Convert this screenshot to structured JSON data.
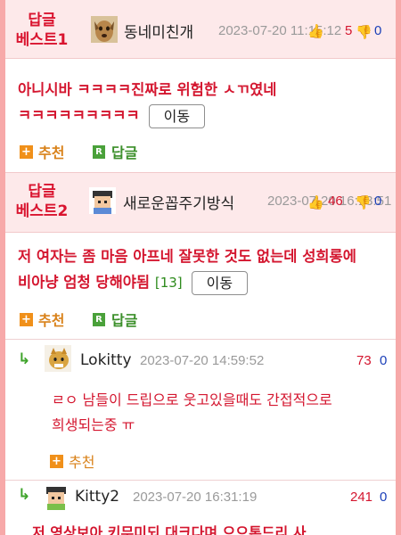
{
  "best1": {
    "label_line1": "답글",
    "label_line2": "베스트1",
    "nickname": "동네미친개",
    "date": "2023-07-20 11:15:12",
    "likes": "5",
    "dislikes": "0",
    "body": "아니시바 ㅋㅋㅋㅋ진짜로 위험한 ㅅㄲ였네 ㅋㅋㅋㅋㅋㅋㅋㅋㅋ",
    "move_label": "이동",
    "recommend_label": "추천",
    "reply_label": "답글"
  },
  "best2": {
    "label_line1": "답글",
    "label_line2": "베스트2",
    "nickname": "새로운꼽주기방식",
    "date": "2023-07-20 16:13:51",
    "likes": "46",
    "dislikes": "0",
    "body": "저 여자는 좀 마음 아프네 잘못한 것도 없는데 성희롱에 비아냥 엄청 당해야됨",
    "reply_count": "[13]",
    "move_label": "이동",
    "recommend_label": "추천",
    "reply_label": "답글"
  },
  "comments": [
    {
      "nickname": "Lokitty",
      "date": "2023-07-20 14:59:52",
      "likes": "73",
      "dislikes": "0",
      "body": "ㄹㅇ 남들이 드립으로 웃고있을때도 간접적으로 희생되는중 ㅠ",
      "recommend_label": "추천"
    },
    {
      "nickname": "Kitty2",
      "date": "2023-07-20 16:31:19",
      "likes": "241",
      "dislikes": "0",
      "body": "저 영상보아 키무미되 대크다며 으으톤드리 사"
    }
  ],
  "icons": {
    "thumb_up": "thumbs-up-icon",
    "thumb_down": "thumbs-down-icon",
    "reply_arrow": "reply-arrow-icon"
  },
  "colors": {
    "accent_red": "#d4162f",
    "dislike_blue": "#1b3fb8",
    "recommend_orange": "#f0901a",
    "reply_green": "#4aa13a",
    "page_bg": "#f7a9a9"
  }
}
